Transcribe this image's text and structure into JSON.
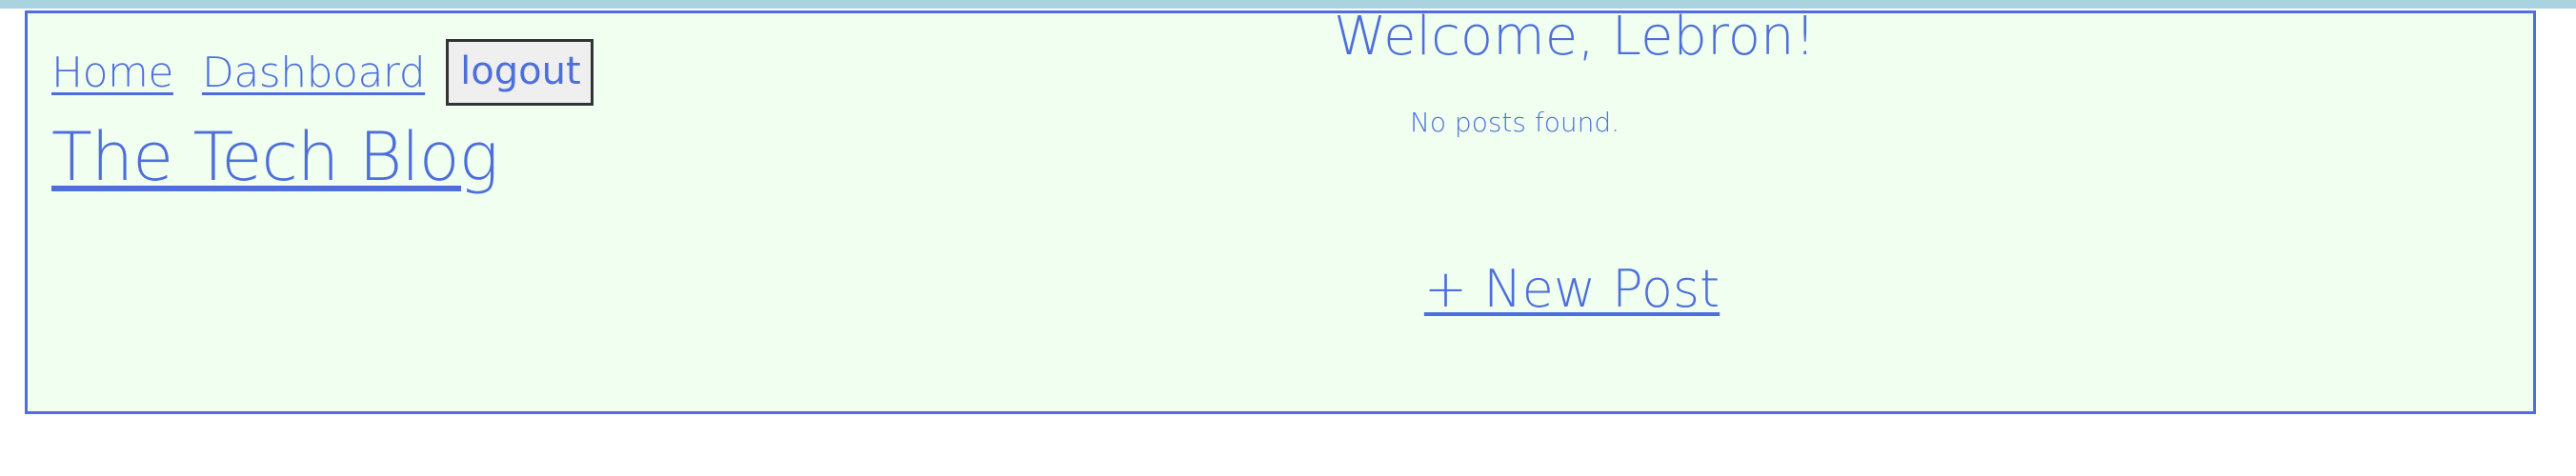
{
  "nav": {
    "home_label": "Home",
    "dashboard_label": "Dashboard",
    "logout_label": "logout"
  },
  "site": {
    "title": "The Tech Blog"
  },
  "dashboard": {
    "welcome_text": "Welcome, Lebron!",
    "empty_text": "No posts found.",
    "new_post_label": "+ New Post"
  },
  "colors": {
    "accent": "#4e6fd9",
    "panel_background": "#f0fff0",
    "top_strip": "#a9d3df"
  }
}
